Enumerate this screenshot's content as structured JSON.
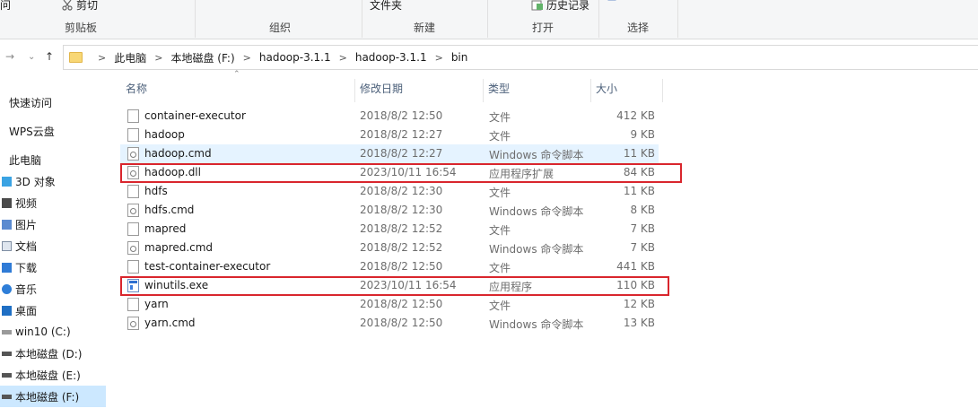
{
  "ribbon": {
    "top_labels": {
      "partial_left": "问",
      "cut": "剪切",
      "folder": "文件夹",
      "history": "历史记录"
    },
    "groups": {
      "clipboard": "剪贴板",
      "organize": "组织",
      "new": "新建",
      "open": "打开",
      "select": "选择"
    }
  },
  "nav": {
    "back_icon": "arrow-left",
    "forward_icon": "arrow-right",
    "recent_icon": "chevron-down",
    "up_icon": "arrow-up",
    "breadcrumb": [
      "此电脑",
      "本地磁盘 (F:)",
      "hadoop-3.1.1",
      "hadoop-3.1.1",
      "bin"
    ]
  },
  "sidebar": {
    "items": [
      {
        "label": "快速访问",
        "icon": "star-icon",
        "active": false
      },
      {
        "label": "WPS云盘",
        "icon": "cloud-icon",
        "active": false
      },
      {
        "label": "此电脑",
        "icon": "computer-icon",
        "active": false
      },
      {
        "label": "3D 对象",
        "icon": "cube-icon",
        "active": false
      },
      {
        "label": "视频",
        "icon": "video-icon",
        "active": false
      },
      {
        "label": "图片",
        "icon": "picture-icon",
        "active": false
      },
      {
        "label": "文档",
        "icon": "document-icon",
        "active": false
      },
      {
        "label": "下载",
        "icon": "download-icon",
        "active": false
      },
      {
        "label": "音乐",
        "icon": "music-icon",
        "active": false
      },
      {
        "label": "桌面",
        "icon": "desktop-icon",
        "active": false
      },
      {
        "label": "win10   (C:)",
        "icon": "drive-icon",
        "active": false
      },
      {
        "label": "本地磁盘 (D:)",
        "icon": "drive-icon",
        "active": false
      },
      {
        "label": "本地磁盘 (E:)",
        "icon": "drive-icon",
        "active": false
      },
      {
        "label": "本地磁盘 (F:)",
        "icon": "drive-icon",
        "active": true
      }
    ]
  },
  "columns": {
    "name": "名称",
    "date": "修改日期",
    "type": "类型",
    "size": "大小"
  },
  "files": [
    {
      "name": "container-executor",
      "date": "2018/8/2 12:50",
      "type": "文件",
      "size": "412 KB",
      "icon": "file-icon",
      "hover": false,
      "highlighted": false
    },
    {
      "name": "hadoop",
      "date": "2018/8/2 12:27",
      "type": "文件",
      "size": "9 KB",
      "icon": "file-icon",
      "hover": false,
      "highlighted": false
    },
    {
      "name": "hadoop.cmd",
      "date": "2018/8/2 12:27",
      "type": "Windows 命令脚本",
      "size": "11 KB",
      "icon": "cmd-script-icon",
      "hover": true,
      "highlighted": false
    },
    {
      "name": "hadoop.dll",
      "date": "2023/10/11 16:54",
      "type": "应用程序扩展",
      "size": "84 KB",
      "icon": "dll-icon",
      "hover": false,
      "highlighted": true
    },
    {
      "name": "hdfs",
      "date": "2018/8/2 12:30",
      "type": "文件",
      "size": "11 KB",
      "icon": "file-icon",
      "hover": false,
      "highlighted": false
    },
    {
      "name": "hdfs.cmd",
      "date": "2018/8/2 12:30",
      "type": "Windows 命令脚本",
      "size": "8 KB",
      "icon": "cmd-script-icon",
      "hover": false,
      "highlighted": false
    },
    {
      "name": "mapred",
      "date": "2018/8/2 12:52",
      "type": "文件",
      "size": "7 KB",
      "icon": "file-icon",
      "hover": false,
      "highlighted": false
    },
    {
      "name": "mapred.cmd",
      "date": "2018/8/2 12:52",
      "type": "Windows 命令脚本",
      "size": "7 KB",
      "icon": "cmd-script-icon",
      "hover": false,
      "highlighted": false
    },
    {
      "name": "test-container-executor",
      "date": "2018/8/2 12:50",
      "type": "文件",
      "size": "441 KB",
      "icon": "file-icon",
      "hover": false,
      "highlighted": false
    },
    {
      "name": "winutils.exe",
      "date": "2023/10/11 16:54",
      "type": "应用程序",
      "size": "110 KB",
      "icon": "exe-icon",
      "hover": false,
      "highlighted": true
    },
    {
      "name": "yarn",
      "date": "2018/8/2 12:50",
      "type": "文件",
      "size": "12 KB",
      "icon": "file-icon",
      "hover": false,
      "highlighted": false
    },
    {
      "name": "yarn.cmd",
      "date": "2018/8/2 12:50",
      "type": "Windows 命令脚本",
      "size": "13 KB",
      "icon": "cmd-script-icon",
      "hover": false,
      "highlighted": false
    }
  ],
  "colors": {
    "highlight_border": "#d9262d",
    "hover_row": "#e5f3ff",
    "active_nav": "#cce8ff"
  }
}
